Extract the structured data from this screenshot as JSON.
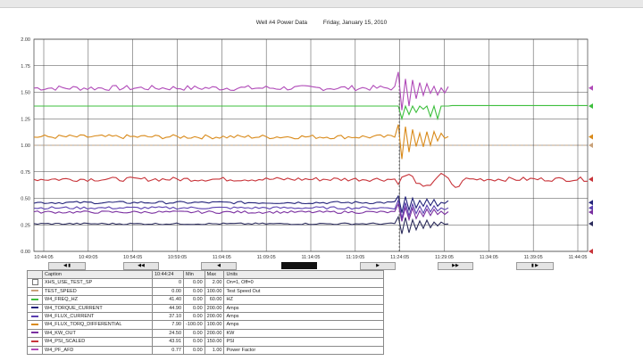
{
  "window": {
    "title": "Well #4 Power Data",
    "date": "Friday, January 15, 2010"
  },
  "chart_data": {
    "type": "line",
    "ylim": [
      0,
      2
    ],
    "yticks": [
      "0.00",
      "0.25",
      "0.50",
      "0.75",
      "1.00",
      "1.25",
      "1.50",
      "1.75",
      "2.00"
    ],
    "xticks": [
      "10:44:05",
      "10:49:05",
      "10:54:05",
      "10:59:05",
      "11:04:05",
      "11:09:05",
      "11:14:05",
      "11:19:05",
      "11:24:05",
      "11:29:05",
      "11:34:05",
      "11:39:05",
      "11:44:05"
    ],
    "series": [
      {
        "name": "W4_PF_AFD",
        "color": "#b04ab8",
        "base": 1.54,
        "noise": 0.025,
        "event": "spike"
      },
      {
        "name": "W4_FREQ_HZ",
        "color": "#3dbf3d",
        "base": 1.37,
        "noise": 0.0,
        "event": "dip"
      },
      {
        "name": "TEST_SPEED",
        "color": "#c9a27a",
        "base": 1.0,
        "noise": 0.0,
        "event": "flatdash"
      },
      {
        "name": "W4_FLUX_TORQ_DIFFERENTIAL",
        "color": "#d98a1a",
        "base": 1.08,
        "noise": 0.02,
        "event": "spike"
      },
      {
        "name": "W4_PSI_SCALED",
        "color": "#c8343a",
        "base": 0.68,
        "noise": 0.02,
        "event": "wave"
      },
      {
        "name": "W4_TORQUE_CURRENT",
        "color": "#23237a",
        "base": 0.46,
        "noise": 0.012,
        "event": "spike"
      },
      {
        "name": "W4_FLUX_CURRENT",
        "color": "#5a3fb0",
        "base": 0.41,
        "noise": 0.012,
        "event": "spike"
      },
      {
        "name": "W4_KW_OUT",
        "color": "#7a2fa0",
        "base": 0.37,
        "noise": 0.012,
        "event": "spike"
      },
      {
        "name": "XHS_USE_TEST_SP",
        "color": "#2c2c5c",
        "base": 0.26,
        "noise": 0.008,
        "event": "spike"
      }
    ]
  },
  "nav": {
    "b1": "◀ ▮",
    "b2": "◀◀",
    "b3": "◀",
    "b4": "▶",
    "b5": "▶▶",
    "b6": "▮ ▶"
  },
  "legend": {
    "headers": {
      "caption": "Caption",
      "value": "10:44:24",
      "min": "Min",
      "max": "Max",
      "units": "Units"
    },
    "rows": [
      {
        "caption": "XHS_USE_TEST_SP",
        "value": "0",
        "min": "0.00",
        "max": "2.00",
        "units": "On=1, Off=0",
        "color": "#ffffff",
        "kind": "box"
      },
      {
        "caption": "TEST_SPEED",
        "value": "0.00",
        "min": "0.00",
        "max": "100.00",
        "units": "Test Speed Out",
        "color": "#c9a27a",
        "kind": "dash"
      },
      {
        "caption": "W4_FREQ_HZ",
        "value": "41.40",
        "min": "0.00",
        "max": "60.00",
        "units": "HZ",
        "color": "#3dbf3d",
        "kind": "line"
      },
      {
        "caption": "W4_TORQUE_CURRENT",
        "value": "44.90",
        "min": "0.00",
        "max": "200.00",
        "units": "Amps",
        "color": "#23237a",
        "kind": "line"
      },
      {
        "caption": "W4_FLUX_CURRENT",
        "value": "37.10",
        "min": "0.00",
        "max": "200.00",
        "units": "Amps",
        "color": "#5a3fb0",
        "kind": "line"
      },
      {
        "caption": "W4_FLUX_TORQ_DIFFERENTIAL",
        "value": "7.90",
        "min": "-100.00",
        "max": "100.00",
        "units": "Amps",
        "color": "#d98a1a",
        "kind": "line"
      },
      {
        "caption": "W4_KW_OUT",
        "value": "24.50",
        "min": "0.00",
        "max": "200.00",
        "units": "KW",
        "color": "#7a2fa0",
        "kind": "line"
      },
      {
        "caption": "W4_PSI_SCALED",
        "value": "43.91",
        "min": "0.00",
        "max": "150.00",
        "units": "PSI",
        "color": "#c8343a",
        "kind": "line"
      },
      {
        "caption": "W4_PF_AFD",
        "value": "0.77",
        "min": "0.00",
        "max": "1.00",
        "units": "Power Factor",
        "color": "#b04ab8",
        "kind": "line"
      }
    ]
  }
}
